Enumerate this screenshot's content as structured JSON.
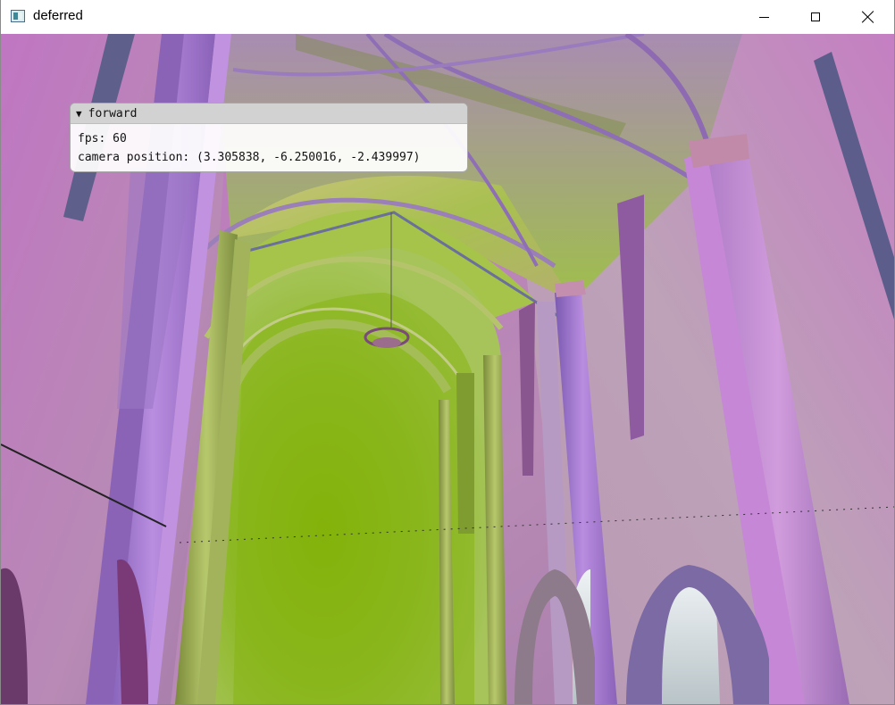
{
  "window": {
    "title": "deferred",
    "controls": {
      "minimize": "minimize",
      "maximize": "maximize",
      "close": "close"
    }
  },
  "scene": {
    "description_icon": "app-icon",
    "colors": {
      "wall_magenta": "#c07cc0",
      "vault_green": "#8fb82a",
      "pillar_violet": "#9a78c8",
      "sky_white": "#dfe6ea"
    }
  },
  "overlay": {
    "header": "forward",
    "collapse_arrow": "▼",
    "fps_label": "fps: 60",
    "camera_label": "camera position: (3.305838, -6.250016, -2.439997)"
  }
}
